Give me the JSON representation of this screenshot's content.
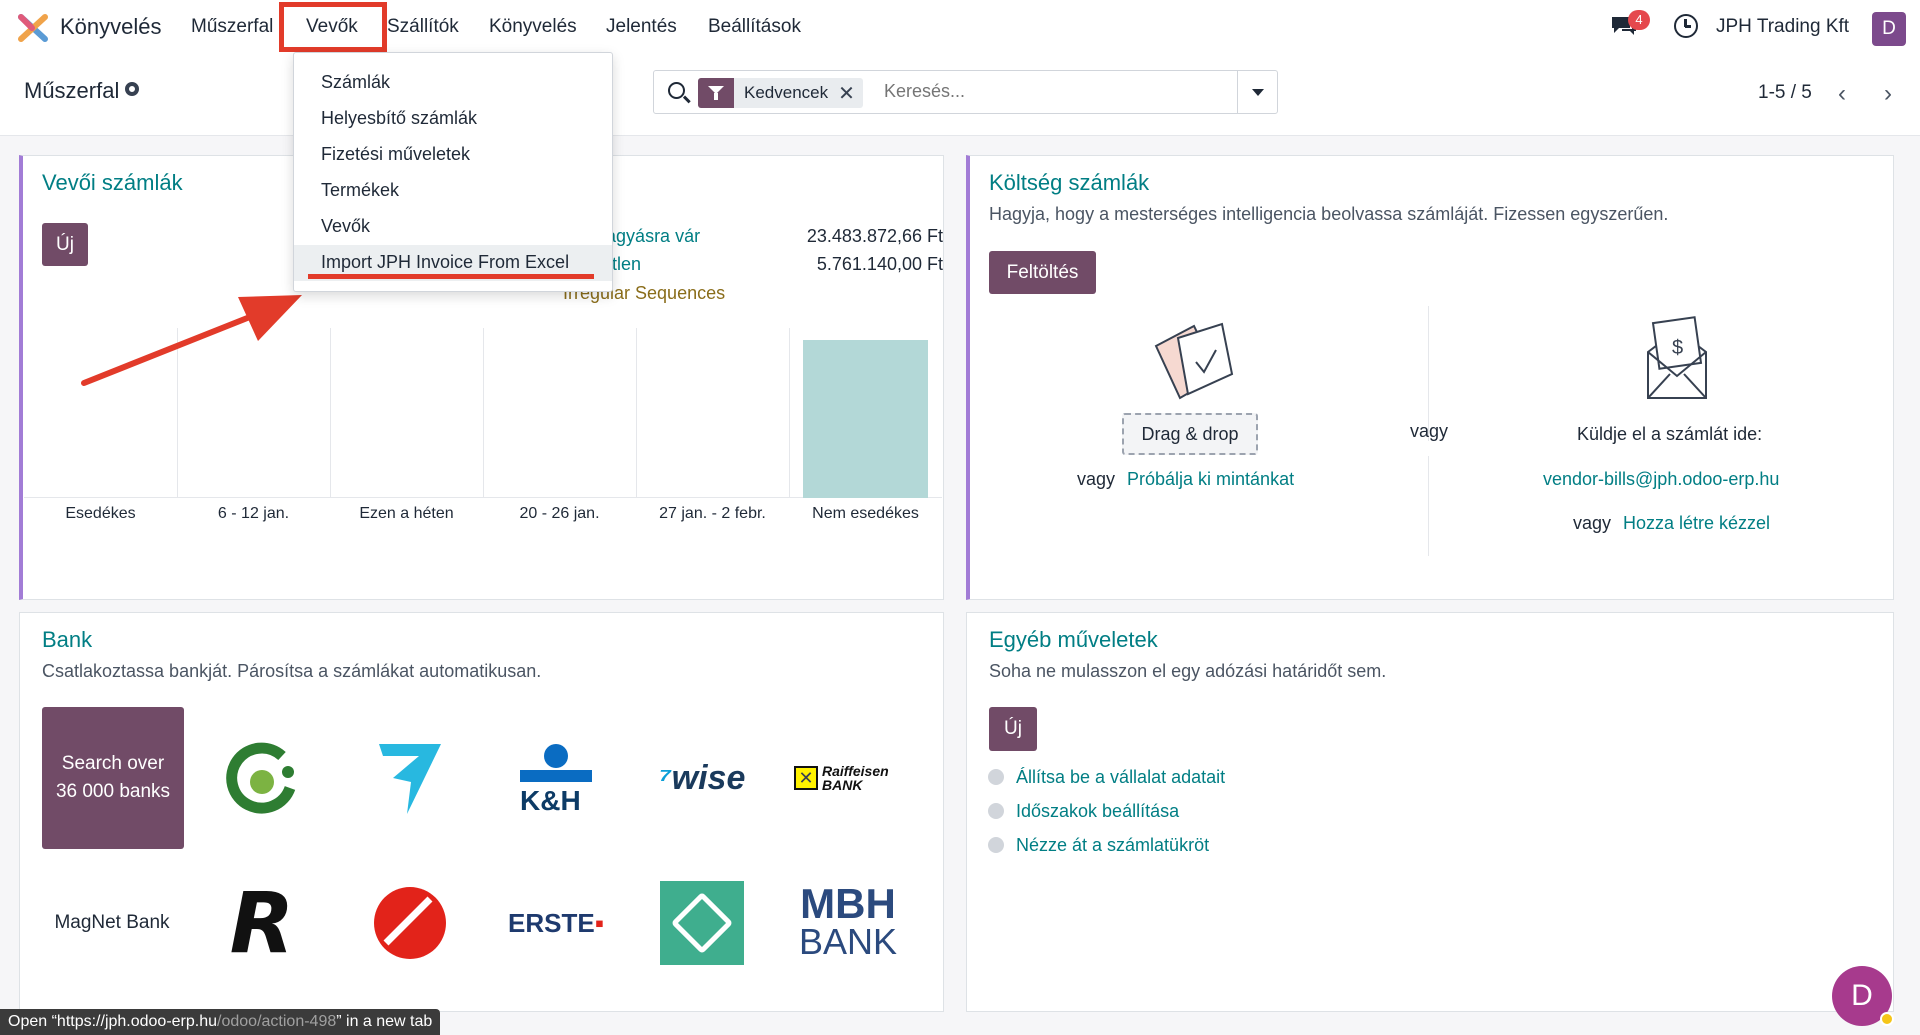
{
  "nav": {
    "app_name": "Könyvelés",
    "menus": [
      "Műszerfal",
      "Vevők",
      "Szállítók",
      "Könyvelés",
      "Jelentés",
      "Beállítások"
    ],
    "chat_badge": "4",
    "company": "JPH Trading Kft",
    "avatar_initial": "D"
  },
  "control": {
    "breadcrumb": "Műszerfal",
    "facet_label": "Kedvencek",
    "search_placeholder": "Keresés...",
    "pager": "1-5 / 5"
  },
  "dropdown": {
    "items": [
      "Számlák",
      "Helyesbítő számlák",
      "Fizetési műveletek",
      "Termékek",
      "Vevők",
      "Import JPH Invoice From Excel"
    ]
  },
  "customer_invoices": {
    "title": "Vevői számlák",
    "new_label": "Új",
    "kpis": [
      {
        "label": "jóváhagyásra vár",
        "value": "23.483.872,66 Ft"
      },
      {
        "label": "Fizetetlen",
        "value": "5.761.140,00 Ft"
      }
    ],
    "warning": "Irregular Sequences",
    "accent_color": "#a27cd6"
  },
  "chart_data": {
    "type": "bar",
    "categories": [
      "Esedékes",
      "6 - 12 jan.",
      "Ezen a héten",
      "20 - 26 jan.",
      "27 jan. - 2 febr.",
      "Nem esedékes"
    ],
    "values": [
      0,
      0,
      0,
      0,
      0,
      1
    ],
    "xlabel": "",
    "ylabel": "",
    "color": "#b3d8d7"
  },
  "expense": {
    "title": "Költség számlák",
    "subtitle": "Hagyja, hogy a mesterséges intelligencia beolvassa számláját. Fizessen egyszerűen.",
    "upload_label": "Feltöltés",
    "dragdrop": "Drag & drop",
    "or": "vagy",
    "try_sample": "Próbálja ki mintánkat",
    "send_to": "Küldje el a számlát ide:",
    "email": "vendor-bills@jph.odoo-erp.hu",
    "manual": "Hozza létre kézzel"
  },
  "bank": {
    "title": "Bank",
    "subtitle": "Csatlakoztassa bankját. Párosítsa a számlákat automatikusan.",
    "search_banks": "Search over 36 000 banks",
    "wise": "wise",
    "raiffeisen": "Raiffeisen BANK",
    "kh": "K&H",
    "magnet": "MagNet Bank",
    "erste": "ERSTE",
    "mbh": "MBH",
    "mbh_bank": "BANK"
  },
  "other": {
    "title": "Egyéb műveletek",
    "subtitle": "Soha ne mulasszon el egy adózási határidőt sem.",
    "new_label": "Új",
    "steps": [
      "Állítsa be a vállalat adatait",
      "Időszakok beállítása",
      "Nézze át a számlatükröt"
    ]
  },
  "statusbar": {
    "prefix": "Open “https://jph.odoo-erp.hu",
    "path": "/odoo/action-498",
    "suffix": "” in a new tab"
  },
  "colors": {
    "brand": "#714b67",
    "link": "#017e84",
    "annotation": "#e23b2a"
  }
}
